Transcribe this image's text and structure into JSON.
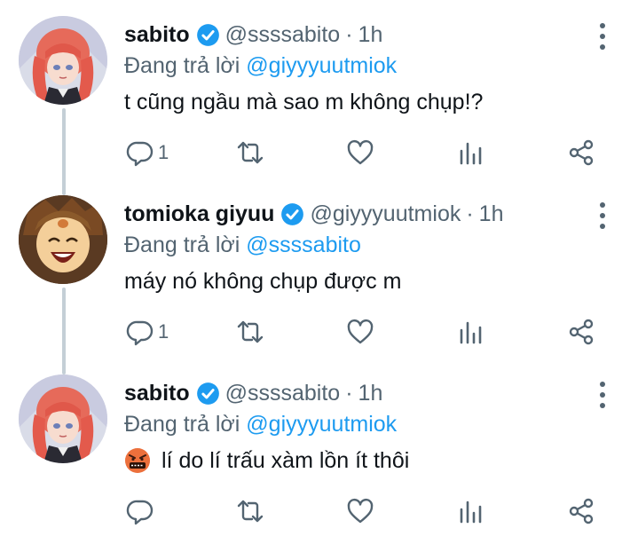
{
  "reply_prefix": "Đang trả lời",
  "tweets": [
    {
      "name": "sabito",
      "handle": "@ssssabito",
      "separator": "·",
      "time": "1h",
      "reply_to": "@giyyyuutmiok",
      "text": "t cũng ngầu mà sao m không chụp!?",
      "reply_count": "1"
    },
    {
      "name": "tomioka giyuu",
      "handle": "@giyyyuutmiok",
      "separator": "·",
      "time": "1h",
      "reply_to": "@ssssabito",
      "text": "máy nó không chụp được m",
      "reply_count": "1"
    },
    {
      "name": "sabito",
      "handle": "@ssssabito",
      "separator": "·",
      "time": "1h",
      "reply_to": "@giyyyuutmiok",
      "text": "lí do lí trấu xàm lồn ít thôi",
      "emoji": "angry-symbols-emoji",
      "reply_count": ""
    }
  ],
  "icons": [
    "verified-badge-icon",
    "more-vertical-icon",
    "reply-icon",
    "retweet-icon",
    "like-icon",
    "views-icon",
    "share-icon"
  ],
  "colors": {
    "accent": "#1d9bf0",
    "secondary_text": "#536471",
    "thread_line": "#c4cfd6"
  }
}
